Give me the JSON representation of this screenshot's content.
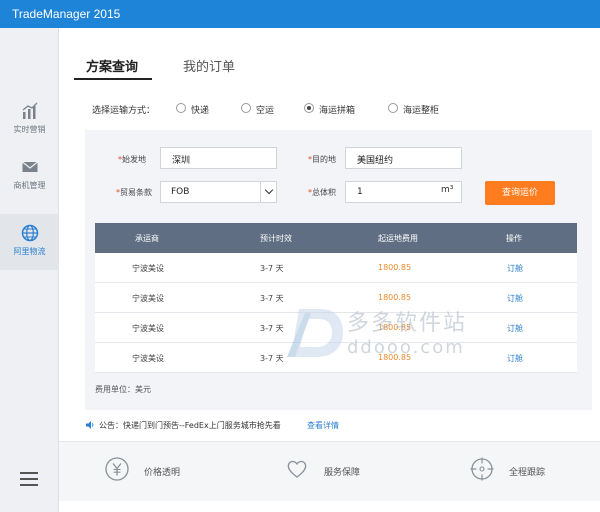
{
  "window": {
    "title": "TradeManager 2015"
  },
  "sidebar": {
    "items": [
      {
        "label": "实时营销",
        "icon": "bar-chart-icon"
      },
      {
        "label": "商机管理",
        "icon": "mail-icon"
      },
      {
        "label": "阿里物流",
        "icon": "globe-icon",
        "active": true
      }
    ],
    "menu_icon": "hamburger-menu-icon"
  },
  "tabs": [
    {
      "label": "方案查询",
      "active": true
    },
    {
      "label": "我的订单",
      "active": false
    }
  ],
  "shipping_mode": {
    "label": "选择运输方式：",
    "options": [
      {
        "label": "快递",
        "checked": false
      },
      {
        "label": "空运",
        "checked": false
      },
      {
        "label": "海运拼箱",
        "checked": true
      },
      {
        "label": "海运整柜",
        "checked": false
      }
    ]
  },
  "form": {
    "origin_label": "始发地",
    "origin_value": "深圳",
    "destination_label": "目的地",
    "destination_value": "美国纽约",
    "trade_terms_label": "贸易条款",
    "trade_terms_value": "FOB",
    "volume_label": "总体积",
    "volume_value": "1",
    "volume_unit": "m³",
    "required_mark": "*",
    "query_button": "查询运价"
  },
  "table": {
    "headers": [
      "承运商",
      "预计时效",
      "起运地费用",
      "操作"
    ],
    "rows": [
      {
        "carrier": "宁波美设",
        "duration": "3-7 天",
        "fee": "1800.85",
        "action": "订舱"
      },
      {
        "carrier": "宁波美设",
        "duration": "3-7 天",
        "fee": "1800.85",
        "action": "订舱"
      },
      {
        "carrier": "宁波美设",
        "duration": "3-7 天",
        "fee": "1800.85",
        "action": "订舱"
      },
      {
        "carrier": "宁波美设",
        "duration": "3-7 天",
        "fee": "1800.85",
        "action": "订舱"
      }
    ],
    "fee_unit": "费用单位：美元"
  },
  "notice": {
    "text": "公告：快递门到门预告--FedEx上门服务城市抢先看",
    "link": "查看详情"
  },
  "footer": {
    "features": [
      {
        "label": "价格透明",
        "icon": "yen-icon"
      },
      {
        "label": "服务保障",
        "icon": "heart-icon"
      },
      {
        "label": "全程跟踪",
        "icon": "crosshair-icon"
      }
    ]
  },
  "watermark": {
    "cn": "多多软件站",
    "en": "ddooo.com"
  },
  "colors": {
    "titlebar": "#1e84d7",
    "accent_orange": "#ff7c1f",
    "link_blue": "#2a7fd0",
    "table_header": "#5f6e82"
  }
}
